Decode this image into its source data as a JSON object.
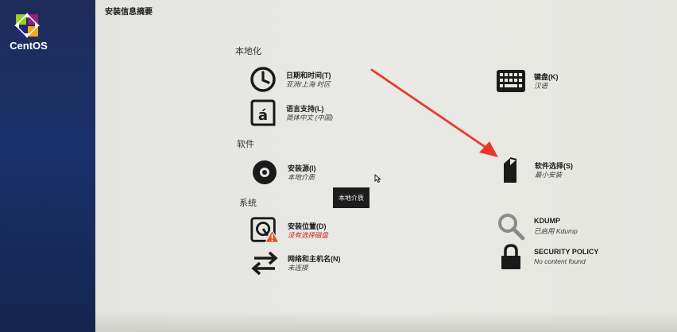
{
  "brand": {
    "name": "CentOS"
  },
  "page": {
    "title": "安装信息摘要"
  },
  "sections": {
    "localization": "本地化",
    "software": "软件",
    "system": "系统"
  },
  "spokes": {
    "datetime": {
      "label": "日期和时间(T)",
      "status": "亚洲/上海 时区"
    },
    "language": {
      "label": "语言支持(L)",
      "status": "简体中文 (中国)"
    },
    "source": {
      "label": "安装源(I)",
      "status": "本地介质"
    },
    "destination": {
      "label": "安装位置(D)",
      "status": "没有选择磁盘"
    },
    "network": {
      "label": "网络和主机名(N)",
      "status": "未连接"
    },
    "keyboard": {
      "label": "键盘(K)",
      "status": "汉语"
    },
    "software_selection": {
      "label": "软件选择(S)",
      "status": "最小安装"
    },
    "kdump": {
      "label": "KDUMP",
      "status": "已启用 Kdump"
    },
    "security": {
      "label": "SECURITY POLICY",
      "status": "No content found"
    }
  },
  "tooltip": {
    "text": "本地介质"
  },
  "colors": {
    "sidebar": "#1a3069",
    "background": "#e6e6e1",
    "warning": "#d0201b",
    "annotation_arrow": "#e8392c"
  },
  "icons": {
    "datetime": "clock-icon",
    "language": "language-icon",
    "source": "disc-icon",
    "destination": "harddisk-icon",
    "network": "network-arrows-icon",
    "keyboard": "keyboard-icon",
    "software_selection": "package-icon",
    "kdump": "magnifier-icon",
    "security": "lock-icon"
  }
}
